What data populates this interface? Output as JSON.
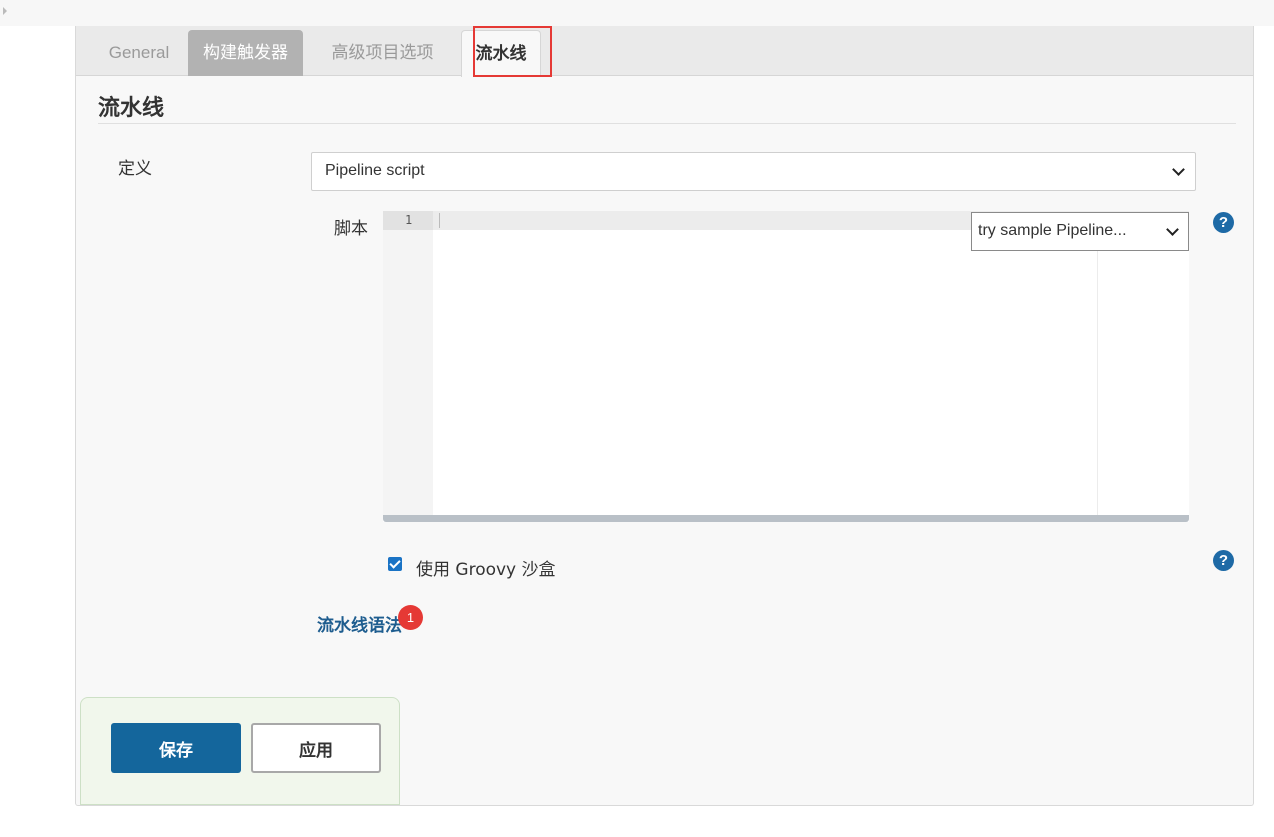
{
  "tabs": {
    "general": "General",
    "triggers": "构建触发器",
    "advanced": "高级项目选项",
    "pipeline": "流水线"
  },
  "section": {
    "title": "流水线"
  },
  "definition": {
    "label": "定义",
    "selected": "Pipeline script"
  },
  "script": {
    "label": "脚本",
    "line_numbers": [
      "1"
    ],
    "sample_select": "try sample Pipeline..."
  },
  "help_icon": "?",
  "sandbox": {
    "label": "使用 Groovy 沙盒",
    "checked": true
  },
  "syntax_link": {
    "label": "流水线语法",
    "badge": "1"
  },
  "buttons": {
    "save": "保存",
    "apply": "应用"
  },
  "colors": {
    "primary": "#14669c",
    "highlight": "#e53935",
    "link": "#1e5d8f"
  }
}
